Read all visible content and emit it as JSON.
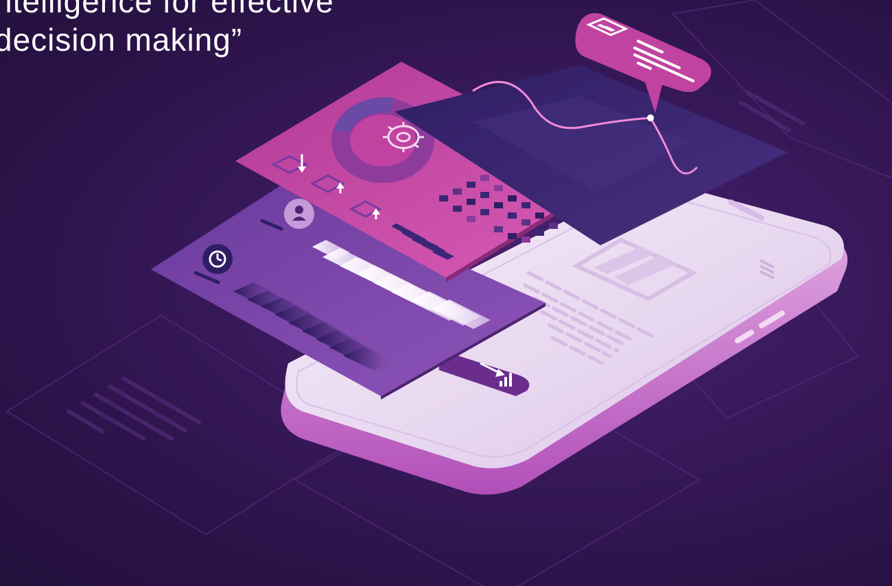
{
  "headline": {
    "line1": "ntelligence for effective",
    "line2": "decision making”"
  },
  "colors": {
    "background": "#2b1247",
    "phone_body": "#eddff3",
    "pink_panel": "#c0439f",
    "purple_panel": "#7a45a6",
    "navy_panel": "#3b2676",
    "bubble": "#c0439f",
    "wave_line": "#f08bd7"
  },
  "icons": [
    "bar-chart-icon",
    "gear-icon",
    "clock-icon",
    "user-icon",
    "download-icon",
    "upload-icon",
    "trend-up-icon"
  ]
}
